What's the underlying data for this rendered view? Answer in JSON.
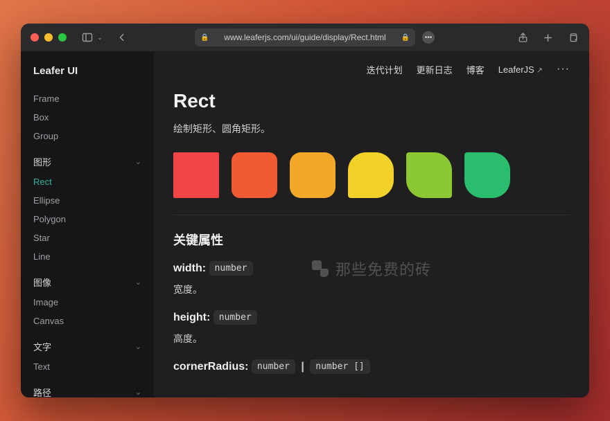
{
  "browser": {
    "url": "www.leaferjs.com/ui/guide/display/Rect.html"
  },
  "brand": "Leafer UI",
  "topnav": {
    "items": [
      {
        "label": "迭代计划"
      },
      {
        "label": "更新日志"
      },
      {
        "label": "博客"
      },
      {
        "label": "LeaferJS",
        "external": true
      }
    ]
  },
  "sidebar": {
    "loose": [
      "Frame",
      "Box",
      "Group"
    ],
    "sections": [
      {
        "title": "图形",
        "items": [
          "Rect",
          "Ellipse",
          "Polygon",
          "Star",
          "Line"
        ],
        "activeIndex": 0
      },
      {
        "title": "图像",
        "items": [
          "Image",
          "Canvas"
        ]
      },
      {
        "title": "文字",
        "items": [
          "Text"
        ]
      },
      {
        "title": "路径",
        "items": []
      }
    ]
  },
  "page": {
    "title": "Rect",
    "subtitle": "绘制矩形、圆角矩形。",
    "swatches": [
      "#f24646",
      "#f25a32",
      "#f2a828",
      "#f2d228",
      "#8cc832",
      "#2bbd6e"
    ],
    "sectionHeading": "关键属性",
    "props": [
      {
        "name": "width:",
        "type": "number",
        "type2": "",
        "desc": "宽度。"
      },
      {
        "name": "height:",
        "type": "number",
        "type2": "",
        "desc": "高度。"
      },
      {
        "name": "cornerRadius:",
        "type": "number",
        "type2": "number []",
        "desc": ""
      }
    ]
  },
  "watermark": "那些免费的砖"
}
